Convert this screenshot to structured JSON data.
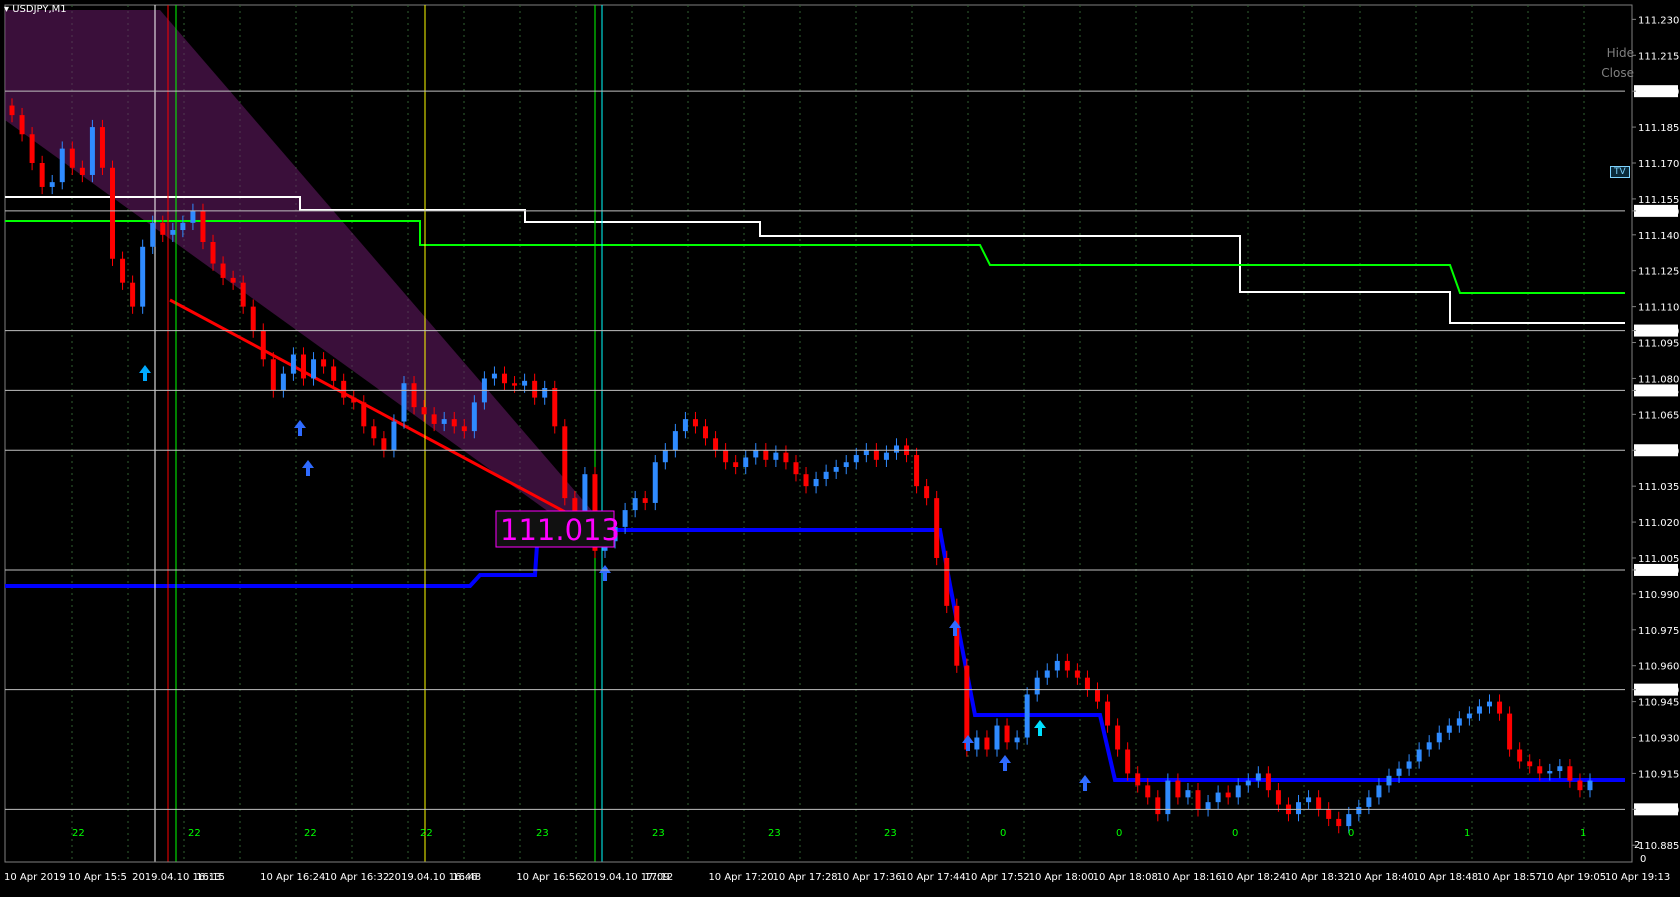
{
  "window": {
    "symbol": "USDJPY,M1",
    "hide_label": "Hide",
    "close_label": "Close",
    "tv_label": "TV"
  },
  "colors": {
    "bull": "#2f8bff",
    "bear": "#ff0000",
    "grid": "#2f5f2f",
    "accent": "#ff00ff"
  },
  "price_label": "111.013",
  "y_axis": {
    "ticks": [
      "111.230",
      "111.215",
      "111.200",
      "111.185",
      "111.170",
      "111.155",
      "111.150",
      "111.140",
      "111.125",
      "111.110",
      "111.100",
      "111.095",
      "111.080",
      "111.075",
      "111.065",
      "111.050",
      "111.035",
      "111.020",
      "111.005",
      "111.000",
      "110.990",
      "110.975",
      "110.960",
      "110.950",
      "110.945",
      "110.930",
      "110.915",
      "110.900",
      "110.885"
    ],
    "boxed": [
      "111.200",
      "111.150",
      "111.100",
      "111.075",
      "111.050",
      "111.000",
      "110.950",
      "110.900"
    ],
    "range": [
      110.878,
      111.236
    ],
    "right_label": "2",
    "right_label_bottom": "0"
  },
  "x_axis": {
    "labels": [
      "10 Apr 2019",
      "10 Apr 15:5",
      "2019.04.10 16:13",
      "16:15",
      "10 Apr 16:24",
      "10 Apr 16:32",
      "2019.04.10 16:46",
      "16:48",
      "10 Apr 16:56",
      "2019.04.10 17:09",
      "17:12",
      "10 Apr 17:20",
      "10 Apr 17:28",
      "10 Apr 17:36",
      "10 Apr 17:44",
      "10 Apr 17:52",
      "10 Apr 18:00",
      "10 Apr 18:08",
      "10 Apr 18:16",
      "10 Apr 18:24",
      "10 Apr 18:32",
      "10 Apr 18:40",
      "10 Apr 18:48",
      "10 Apr 18:57",
      "10 Apr 19:05",
      "10 Apr 19:13"
    ],
    "counters": [
      "22",
      "22",
      "22",
      "22",
      "23",
      "23",
      "23",
      "23",
      "0",
      "0",
      "0",
      "0",
      "1",
      "1"
    ]
  },
  "chart_data": {
    "type": "candlestick",
    "symbol": "USDJPY",
    "timeframe": "M1",
    "ylim": [
      110.878,
      111.236
    ],
    "closes": [
      111.19,
      111.182,
      111.17,
      111.16,
      111.162,
      111.176,
      111.168,
      111.165,
      111.185,
      111.168,
      111.13,
      111.12,
      111.11,
      111.135,
      111.145,
      111.14,
      111.142,
      111.145,
      111.15,
      111.137,
      111.128,
      111.122,
      111.12,
      111.11,
      111.1,
      111.088,
      111.075,
      111.082,
      111.09,
      111.08,
      111.088,
      111.085,
      111.079,
      111.072,
      111.07,
      111.06,
      111.055,
      111.05,
      111.062,
      111.078,
      111.068,
      111.065,
      111.061,
      111.063,
      111.06,
      111.058,
      111.07,
      111.08,
      111.082,
      111.078,
      111.077,
      111.079,
      111.072,
      111.076,
      111.06,
      111.03,
      111.022,
      111.04,
      111.008,
      111.012,
      111.018,
      111.025,
      111.03,
      111.028,
      111.045,
      111.05,
      111.058,
      111.063,
      111.06,
      111.055,
      111.05,
      111.045,
      111.043,
      111.047,
      111.05,
      111.046,
      111.049,
      111.045,
      111.04,
      111.035,
      111.038,
      111.041,
      111.043,
      111.045,
      111.048,
      111.05,
      111.046,
      111.049,
      111.052,
      111.048,
      111.035,
      111.03,
      111.005,
      110.985,
      110.96,
      110.925,
      110.93,
      110.925,
      110.935,
      110.928,
      110.93,
      110.948,
      110.955,
      110.958,
      110.962,
      110.958,
      110.955,
      110.95,
      110.945,
      110.935,
      110.925,
      110.915,
      110.91,
      110.905,
      110.898,
      110.912,
      110.905,
      110.908,
      110.9,
      110.903,
      110.907,
      110.905,
      110.91,
      110.912,
      110.915,
      110.908,
      110.902,
      110.898,
      110.903,
      110.905,
      110.9,
      110.896,
      110.893,
      110.898,
      110.901,
      110.905,
      110.91,
      110.914,
      110.917,
      110.92,
      110.925,
      110.928,
      110.932,
      110.935,
      110.938,
      110.94,
      110.943,
      110.945,
      110.94,
      110.925,
      110.92,
      110.918,
      110.915,
      110.916,
      110.918,
      110.912,
      110.908,
      110.912
    ]
  }
}
